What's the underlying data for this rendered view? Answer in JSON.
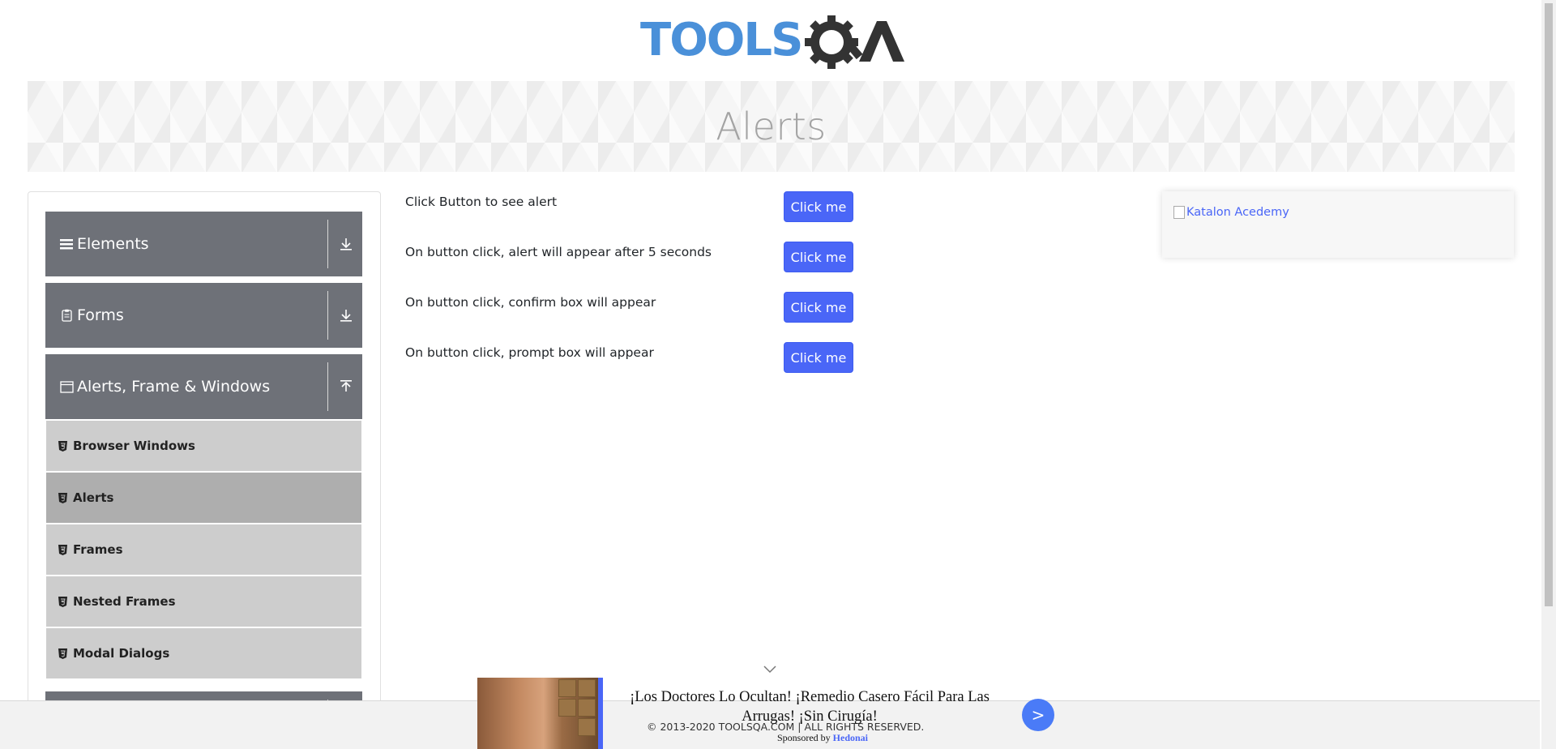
{
  "header": {
    "logo_text": "TOOLSQA",
    "page_title": "Alerts"
  },
  "sidebar": {
    "groups": [
      {
        "label": "Elements",
        "icon": "hamburger-icon",
        "state": "collapsed"
      },
      {
        "label": "Forms",
        "icon": "clipboard-icon",
        "state": "collapsed"
      },
      {
        "label": "Alerts, Frame & Windows",
        "icon": "window-icon",
        "state": "expanded"
      }
    ],
    "items": [
      {
        "label": "Browser Windows",
        "active": false
      },
      {
        "label": "Alerts",
        "active": true
      },
      {
        "label": "Frames",
        "active": false
      },
      {
        "label": "Nested Frames",
        "active": false
      },
      {
        "label": "Modal Dialogs",
        "active": false
      }
    ]
  },
  "main": {
    "rows": [
      {
        "text": "Click Button to see alert",
        "button": "Click me"
      },
      {
        "text": "On button click, alert will appear after 5 seconds",
        "button": "Click me"
      },
      {
        "text": "On button click, confirm box will appear",
        "button": "Click me"
      },
      {
        "text": "On button click, prompt box will appear",
        "button": "Click me"
      }
    ]
  },
  "ad_right": {
    "alt_text": "Katalon Acedemy"
  },
  "footer": {
    "copyright": "© 2013-2020 TOOLSQA.COM | ALL RIGHTS RESERVED."
  },
  "sponsored_ad": {
    "title": "¡Los Doctores Lo Ocultan! ¡Remedio Casero Fácil Para Las Arrugas! ¡Sin Cirugía!",
    "sponsored_by_label": "Sponsored by",
    "sponsor": "Hedonai",
    "go_label": ">"
  },
  "colors": {
    "accent": "#4a66f7",
    "sidebar_group_bg": "#6e7178",
    "sidebar_item_bg": "#cdcdcd",
    "sidebar_item_active_bg": "#aeaeae"
  }
}
